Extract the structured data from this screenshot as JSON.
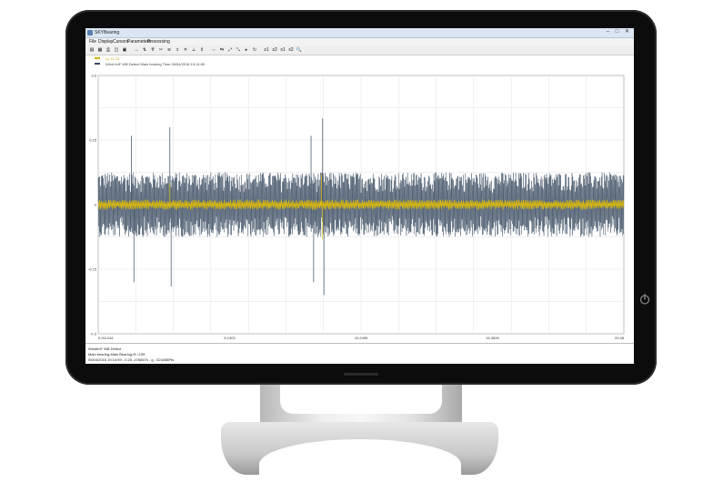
{
  "app": {
    "title": "SKYBearing",
    "window_controls": [
      "–",
      "□",
      "✕"
    ]
  },
  "menu": [
    "File",
    "Display",
    "Cursors",
    "Parameters",
    "Processing"
  ],
  "toolbar": {
    "buttons": [
      "▤",
      "▦",
      "⎙",
      "◫",
      "▣",
      "↔",
      "⇅",
      "⇈",
      "✂",
      "≋",
      "ↄ",
      "✕",
      "⟂",
      "⇕",
      "⇔",
      "⇆",
      "⤢",
      "⤡",
      "▸",
      "↻",
      "z1",
      "z2",
      "x1",
      "x2",
      "🔍"
    ]
  },
  "legend": {
    "line1": "Lp 11 Ot",
    "line2": "Wind ImF WB Defect Main bearing Time 05/04/2016 15:14:59"
  },
  "chart_data": {
    "type": "line",
    "title": "",
    "xlabel": "",
    "ylabel": "",
    "yticks": [
      "0.3",
      "0.15",
      "0",
      "-0.15",
      "-0.3"
    ],
    "xticks": [
      "0.011244",
      "5.1303",
      "10.2495",
      "15.3626",
      "20.48"
    ],
    "xlim": [
      0.011244,
      20.48
    ],
    "ylim": [
      -0.3,
      0.3
    ],
    "grid": true,
    "series": [
      {
        "color": "#3a4b60",
        "envelope_amplitude": 0.075,
        "spikes": [
          {
            "x": 1.3,
            "y": 0.16
          },
          {
            "x": 1.4,
            "y": -0.18
          },
          {
            "x": 2.8,
            "y": 0.18
          },
          {
            "x": 2.85,
            "y": -0.19
          },
          {
            "x": 8.3,
            "y": 0.16
          },
          {
            "x": 8.4,
            "y": -0.18
          },
          {
            "x": 8.75,
            "y": 0.2
          },
          {
            "x": 8.8,
            "y": -0.21
          }
        ]
      },
      {
        "color": "#e6c100",
        "envelope_amplitude": 0.012,
        "spikes": [
          {
            "x": 2.8,
            "y": 0.05
          },
          {
            "x": 8.7,
            "y": 0.07
          },
          {
            "x": 8.75,
            "y": -0.08
          }
        ]
      }
    ]
  },
  "status": {
    "line1": "WindImF WB Defect",
    "line2": "Main bearing-Main Bearing-R:=135",
    "line3": "05/04/2016 15:14:59 - 0.25 -476667s - g - 524288Pts"
  },
  "colors": {
    "bezel": "#0c0c0c",
    "signal": "#3a4b60",
    "highlight": "#e6c100",
    "grid": "#e1e1e1"
  },
  "icons": {
    "power": "power-icon",
    "app": "app-icon"
  }
}
